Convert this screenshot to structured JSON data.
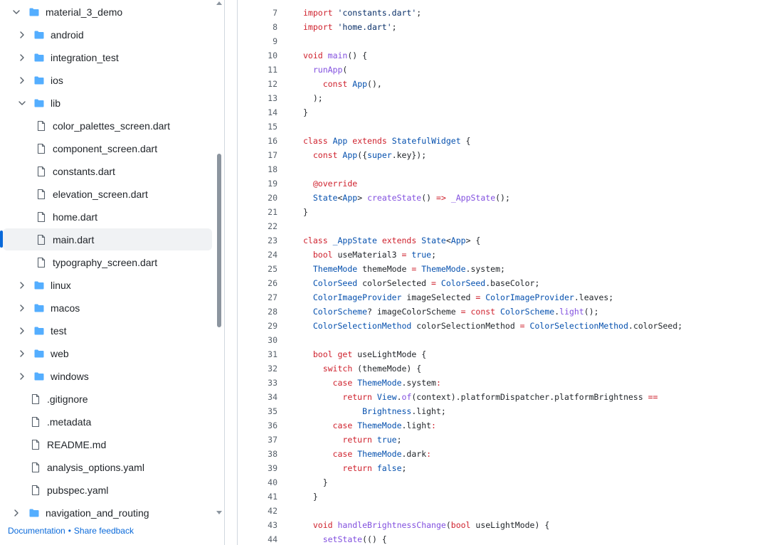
{
  "sidebar": {
    "tree": [
      {
        "label": "material_3_demo",
        "kind": "folder",
        "expanded": true,
        "selected": false,
        "depth": 0
      },
      {
        "label": "android",
        "kind": "folder",
        "expanded": false,
        "selected": false,
        "depth": 1
      },
      {
        "label": "integration_test",
        "kind": "folder",
        "expanded": false,
        "selected": false,
        "depth": 1
      },
      {
        "label": "ios",
        "kind": "folder",
        "expanded": false,
        "selected": false,
        "depth": 1
      },
      {
        "label": "lib",
        "kind": "folder",
        "expanded": true,
        "selected": false,
        "depth": 1
      },
      {
        "label": "color_palettes_screen.dart",
        "kind": "file",
        "selected": false,
        "depth": 2
      },
      {
        "label": "component_screen.dart",
        "kind": "file",
        "selected": false,
        "depth": 2
      },
      {
        "label": "constants.dart",
        "kind": "file",
        "selected": false,
        "depth": 2
      },
      {
        "label": "elevation_screen.dart",
        "kind": "file",
        "selected": false,
        "depth": 2
      },
      {
        "label": "home.dart",
        "kind": "file",
        "selected": false,
        "depth": 2
      },
      {
        "label": "main.dart",
        "kind": "file",
        "selected": true,
        "depth": 2
      },
      {
        "label": "typography_screen.dart",
        "kind": "file",
        "selected": false,
        "depth": 2
      },
      {
        "label": "linux",
        "kind": "folder",
        "expanded": false,
        "selected": false,
        "depth": 1
      },
      {
        "label": "macos",
        "kind": "folder",
        "expanded": false,
        "selected": false,
        "depth": 1
      },
      {
        "label": "test",
        "kind": "folder",
        "expanded": false,
        "selected": false,
        "depth": 1
      },
      {
        "label": "web",
        "kind": "folder",
        "expanded": false,
        "selected": false,
        "depth": 1
      },
      {
        "label": "windows",
        "kind": "folder",
        "expanded": false,
        "selected": false,
        "depth": 1
      },
      {
        "label": ".gitignore",
        "kind": "file",
        "selected": false,
        "depth": 1
      },
      {
        "label": ".metadata",
        "kind": "file",
        "selected": false,
        "depth": 1
      },
      {
        "label": "README.md",
        "kind": "file",
        "selected": false,
        "depth": 1
      },
      {
        "label": "analysis_options.yaml",
        "kind": "file",
        "selected": false,
        "depth": 1
      },
      {
        "label": "pubspec.yaml",
        "kind": "file",
        "selected": false,
        "depth": 1
      },
      {
        "label": "navigation_and_routing",
        "kind": "folder",
        "expanded": false,
        "selected": false,
        "depth": 0
      }
    ]
  },
  "footer": {
    "documentation": "Documentation",
    "separator": "•",
    "share_feedback": "Share feedback"
  },
  "code": {
    "lines": [
      {
        "num": "7",
        "tokens": [
          [
            "kw",
            "import"
          ],
          [
            "",
            "' "
          ],
          [
            "st",
            "'constants.dart'"
          ],
          [
            "",
            ";"
          ]
        ]
      },
      {
        "num": "8",
        "tokens": [
          [
            "kw",
            "import"
          ],
          [
            "",
            " "
          ],
          [
            "st",
            "'home.dart'"
          ],
          [
            "",
            ";"
          ]
        ]
      },
      {
        "num": "9",
        "tokens": []
      },
      {
        "num": "10",
        "tokens": [
          [
            "kw",
            "void"
          ],
          [
            "",
            " "
          ],
          [
            "fn",
            "main"
          ],
          [
            "",
            "() {"
          ]
        ]
      },
      {
        "num": "11",
        "tokens": [
          [
            "",
            "  "
          ],
          [
            "fn",
            "runApp"
          ],
          [
            "",
            "("
          ]
        ]
      },
      {
        "num": "12",
        "tokens": [
          [
            "",
            "    "
          ],
          [
            "kw",
            "const"
          ],
          [
            "",
            " "
          ],
          [
            "ty",
            "App"
          ],
          [
            "",
            "(),"
          ]
        ]
      },
      {
        "num": "13",
        "tokens": [
          [
            "",
            "  );"
          ]
        ]
      },
      {
        "num": "14",
        "tokens": [
          [
            "",
            "}"
          ]
        ]
      },
      {
        "num": "15",
        "tokens": []
      },
      {
        "num": "16",
        "tokens": [
          [
            "kw",
            "class"
          ],
          [
            "",
            " "
          ],
          [
            "ty",
            "App"
          ],
          [
            "",
            " "
          ],
          [
            "kw",
            "extends"
          ],
          [
            "",
            " "
          ],
          [
            "ty",
            "StatefulWidget"
          ],
          [
            "",
            " {"
          ]
        ]
      },
      {
        "num": "17",
        "tokens": [
          [
            "",
            "  "
          ],
          [
            "kw",
            "const"
          ],
          [
            "",
            " "
          ],
          [
            "ty",
            "App"
          ],
          [
            "",
            "({"
          ],
          [
            "ty",
            "super"
          ],
          [
            "",
            ".key});"
          ]
        ]
      },
      {
        "num": "18",
        "tokens": []
      },
      {
        "num": "19",
        "tokens": [
          [
            "",
            "  "
          ],
          [
            "an",
            "@override"
          ]
        ]
      },
      {
        "num": "20",
        "tokens": [
          [
            "",
            "  "
          ],
          [
            "ty",
            "State"
          ],
          [
            "",
            "<"
          ],
          [
            "ty",
            "App"
          ],
          [
            "",
            "> "
          ],
          [
            "fn",
            "createState"
          ],
          [
            "",
            "() "
          ],
          [
            "kw",
            "=>"
          ],
          [
            "",
            " "
          ],
          [
            "fn",
            "_AppState"
          ],
          [
            "",
            "();"
          ]
        ]
      },
      {
        "num": "21",
        "tokens": [
          [
            "",
            "}"
          ]
        ]
      },
      {
        "num": "22",
        "tokens": []
      },
      {
        "num": "23",
        "tokens": [
          [
            "kw",
            "class"
          ],
          [
            "",
            " "
          ],
          [
            "ty",
            "_AppState"
          ],
          [
            "",
            " "
          ],
          [
            "kw",
            "extends"
          ],
          [
            "",
            " "
          ],
          [
            "ty",
            "State"
          ],
          [
            "",
            "<"
          ],
          [
            "ty",
            "App"
          ],
          [
            "",
            "> {"
          ]
        ]
      },
      {
        "num": "24",
        "tokens": [
          [
            "",
            "  "
          ],
          [
            "kw",
            "bool"
          ],
          [
            "",
            " useMaterial3 "
          ],
          [
            "kw",
            "="
          ],
          [
            "",
            " "
          ],
          [
            "ty",
            "true"
          ],
          [
            "",
            ";"
          ]
        ]
      },
      {
        "num": "25",
        "tokens": [
          [
            "",
            "  "
          ],
          [
            "ty",
            "ThemeMode"
          ],
          [
            "",
            " themeMode "
          ],
          [
            "kw",
            "="
          ],
          [
            "",
            " "
          ],
          [
            "ty",
            "ThemeMode"
          ],
          [
            "",
            ".system;"
          ]
        ]
      },
      {
        "num": "26",
        "tokens": [
          [
            "",
            "  "
          ],
          [
            "ty",
            "ColorSeed"
          ],
          [
            "",
            " colorSelected "
          ],
          [
            "kw",
            "="
          ],
          [
            "",
            " "
          ],
          [
            "ty",
            "ColorSeed"
          ],
          [
            "",
            ".baseColor;"
          ]
        ]
      },
      {
        "num": "27",
        "tokens": [
          [
            "",
            "  "
          ],
          [
            "ty",
            "ColorImageProvider"
          ],
          [
            "",
            " imageSelected "
          ],
          [
            "kw",
            "="
          ],
          [
            "",
            " "
          ],
          [
            "ty",
            "ColorImageProvider"
          ],
          [
            "",
            ".leaves;"
          ]
        ]
      },
      {
        "num": "28",
        "tokens": [
          [
            "",
            "  "
          ],
          [
            "ty",
            "ColorScheme"
          ],
          [
            "",
            "? imageColorScheme "
          ],
          [
            "kw",
            "="
          ],
          [
            "",
            " "
          ],
          [
            "kw",
            "const"
          ],
          [
            "",
            " "
          ],
          [
            "ty",
            "ColorScheme"
          ],
          [
            "",
            "."
          ],
          [
            "fn",
            "light"
          ],
          [
            "",
            "();"
          ]
        ]
      },
      {
        "num": "29",
        "tokens": [
          [
            "",
            "  "
          ],
          [
            "ty",
            "ColorSelectionMethod"
          ],
          [
            "",
            " colorSelectionMethod "
          ],
          [
            "kw",
            "="
          ],
          [
            "",
            " "
          ],
          [
            "ty",
            "ColorSelectionMethod"
          ],
          [
            "",
            ".colorSeed;"
          ]
        ]
      },
      {
        "num": "30",
        "tokens": []
      },
      {
        "num": "31",
        "tokens": [
          [
            "",
            "  "
          ],
          [
            "kw",
            "bool"
          ],
          [
            "",
            " "
          ],
          [
            "kw",
            "get"
          ],
          [
            "",
            " useLightMode {"
          ]
        ]
      },
      {
        "num": "32",
        "tokens": [
          [
            "",
            "    "
          ],
          [
            "kw",
            "switch"
          ],
          [
            "",
            " (themeMode) {"
          ]
        ]
      },
      {
        "num": "33",
        "tokens": [
          [
            "",
            "      "
          ],
          [
            "kw",
            "case"
          ],
          [
            "",
            " "
          ],
          [
            "ty",
            "ThemeMode"
          ],
          [
            "",
            ".system"
          ],
          [
            "kw",
            ":"
          ]
        ]
      },
      {
        "num": "34",
        "tokens": [
          [
            "",
            "        "
          ],
          [
            "kw",
            "return"
          ],
          [
            "",
            " "
          ],
          [
            "ty",
            "View"
          ],
          [
            "",
            "."
          ],
          [
            "fn",
            "of"
          ],
          [
            "",
            "(context).platformDispatcher.platformBrightness "
          ],
          [
            "kw",
            "=="
          ]
        ]
      },
      {
        "num": "35",
        "tokens": [
          [
            "",
            "            "
          ],
          [
            "ty",
            "Brightness"
          ],
          [
            "",
            ".light;"
          ]
        ]
      },
      {
        "num": "36",
        "tokens": [
          [
            "",
            "      "
          ],
          [
            "kw",
            "case"
          ],
          [
            "",
            " "
          ],
          [
            "ty",
            "ThemeMode"
          ],
          [
            "",
            ".light"
          ],
          [
            "kw",
            ":"
          ]
        ]
      },
      {
        "num": "37",
        "tokens": [
          [
            "",
            "        "
          ],
          [
            "kw",
            "return"
          ],
          [
            "",
            " "
          ],
          [
            "ty",
            "true"
          ],
          [
            "",
            ";"
          ]
        ]
      },
      {
        "num": "38",
        "tokens": [
          [
            "",
            "      "
          ],
          [
            "kw",
            "case"
          ],
          [
            "",
            " "
          ],
          [
            "ty",
            "ThemeMode"
          ],
          [
            "",
            ".dark"
          ],
          [
            "kw",
            ":"
          ]
        ]
      },
      {
        "num": "39",
        "tokens": [
          [
            "",
            "        "
          ],
          [
            "kw",
            "return"
          ],
          [
            "",
            " "
          ],
          [
            "ty",
            "false"
          ],
          [
            "",
            ";"
          ]
        ]
      },
      {
        "num": "40",
        "tokens": [
          [
            "",
            "    }"
          ]
        ]
      },
      {
        "num": "41",
        "tokens": [
          [
            "",
            "  }"
          ]
        ]
      },
      {
        "num": "42",
        "tokens": []
      },
      {
        "num": "43",
        "tokens": [
          [
            "",
            "  "
          ],
          [
            "kw",
            "void"
          ],
          [
            "",
            " "
          ],
          [
            "fn",
            "handleBrightnessChange"
          ],
          [
            "",
            "("
          ],
          [
            "kw",
            "bool"
          ],
          [
            "",
            " useLightMode) {"
          ]
        ]
      },
      {
        "num": "44",
        "tokens": [
          [
            "",
            "    "
          ],
          [
            "fn",
            "setState"
          ],
          [
            "",
            "(() {"
          ]
        ]
      }
    ]
  },
  "colors": {
    "accent": "#0969da",
    "folder": "#54aeff",
    "keyword": "#cf222e",
    "type": "#0550ae",
    "function": "#8250df",
    "string": "#0a3069"
  }
}
